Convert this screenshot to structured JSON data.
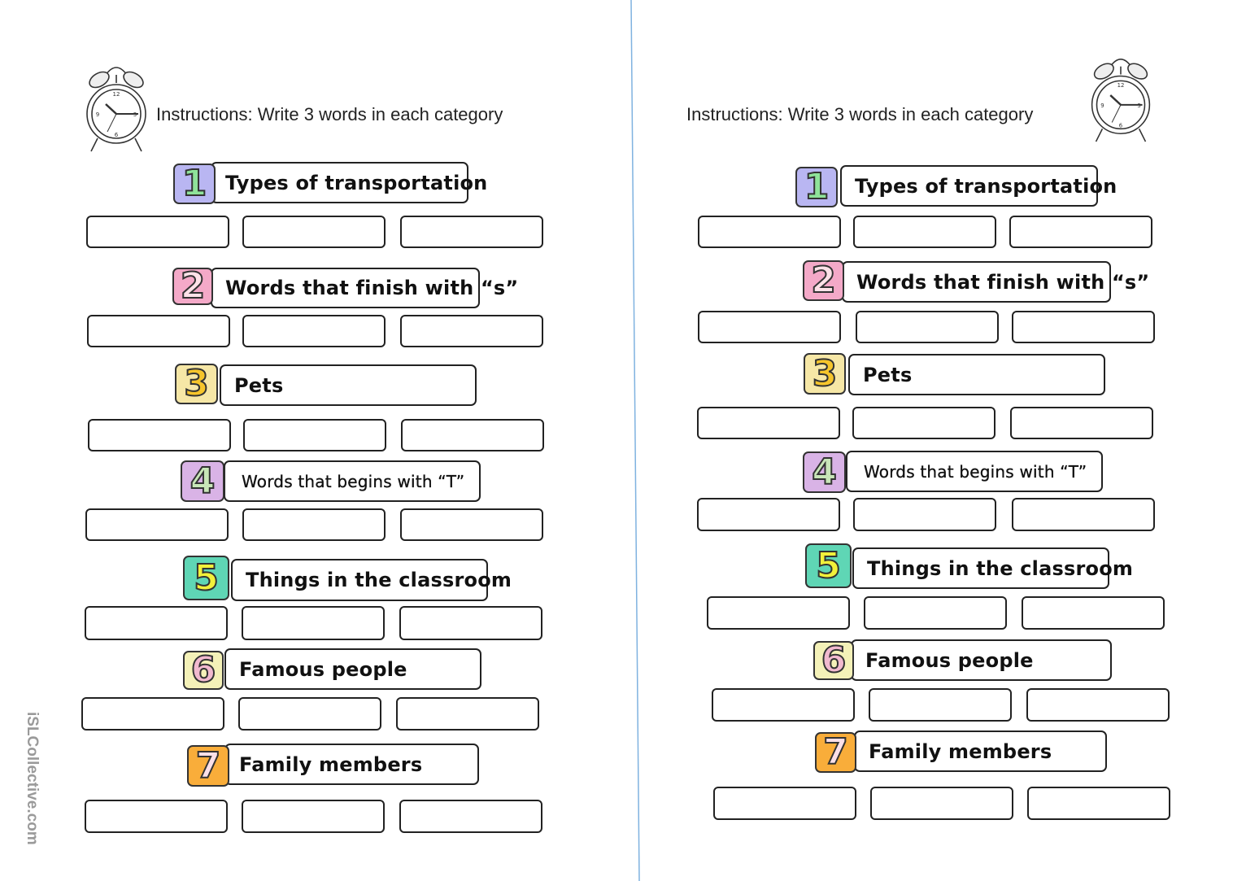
{
  "pages": [
    {
      "instructions": "Instructions: Write 3 words in each category",
      "categories": [
        {
          "number": "1",
          "label": "Types of transportation"
        },
        {
          "number": "2",
          "label": "Words that finish with “s”"
        },
        {
          "number": "3",
          "label": "Pets"
        },
        {
          "number": "4",
          "label": "Words that begins with “T”"
        },
        {
          "number": "5",
          "label": "Things in the classroom"
        },
        {
          "number": "6",
          "label": "Famous people"
        },
        {
          "number": "7",
          "label": "Family members"
        }
      ]
    },
    {
      "instructions": "Instructions: Write 3 words in each category",
      "categories": [
        {
          "number": "1",
          "label": "Types of transportation"
        },
        {
          "number": "2",
          "label": "Words that finish with “s”"
        },
        {
          "number": "3",
          "label": "Pets"
        },
        {
          "number": "4",
          "label": "Words that begins with “T”"
        },
        {
          "number": "5",
          "label": "Things in the classroom"
        },
        {
          "number": "6",
          "label": "Famous people"
        },
        {
          "number": "7",
          "label": "Family members"
        }
      ]
    }
  ],
  "badge_colors": [
    {
      "box": "#b9b6f2",
      "numeral": "#8fe39a"
    },
    {
      "box": "#f4a9c8",
      "numeral": "#fde2e8"
    },
    {
      "box": "#f6e7a6",
      "numeral": "#f6c52b"
    },
    {
      "box": "#d9b3e6",
      "numeral": "#c8e6b8"
    },
    {
      "box": "#5fd6b5",
      "numeral": "#f2f03a"
    },
    {
      "box": "#f4f1b8",
      "numeral": "#f1b9cf"
    },
    {
      "box": "#f9ad3a",
      "numeral": "#fbe0e8"
    }
  ],
  "watermark": "iSLCollective.com",
  "divider_color": "#7fb2e0",
  "icons": [
    "alarm-clock-icon"
  ]
}
